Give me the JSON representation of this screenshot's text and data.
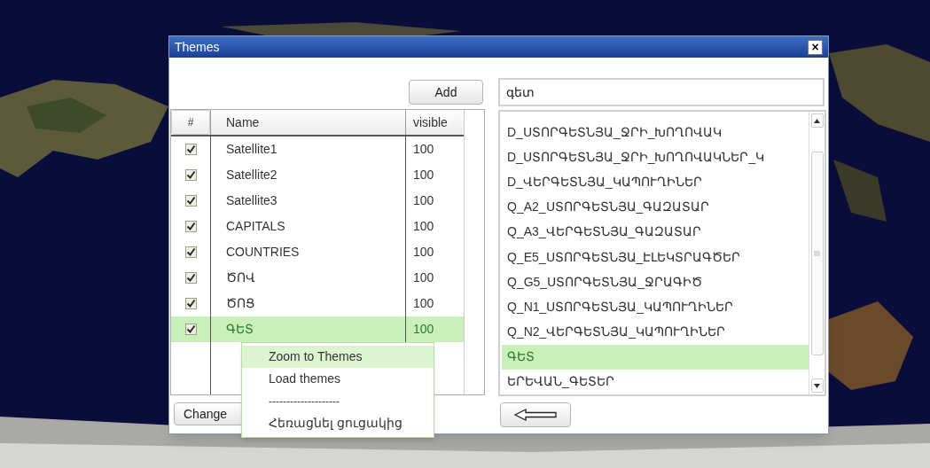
{
  "window": {
    "title": "Themes",
    "close": "×"
  },
  "add_button": "Add",
  "search": {
    "value": "գետ"
  },
  "table": {
    "columns": [
      "#",
      "Name",
      "visible"
    ],
    "rows": [
      {
        "checked": true,
        "name": "Satellite1",
        "visible": "100",
        "selected": false
      },
      {
        "checked": true,
        "name": "Satellite2",
        "visible": "100",
        "selected": false
      },
      {
        "checked": true,
        "name": "Satellite3",
        "visible": "100",
        "selected": false
      },
      {
        "checked": true,
        "name": "CAPITALS",
        "visible": "100",
        "selected": false
      },
      {
        "checked": true,
        "name": "COUNTRIES",
        "visible": "100",
        "selected": false
      },
      {
        "checked": true,
        "name": "ԾՈՎ",
        "visible": "100",
        "selected": false
      },
      {
        "checked": true,
        "name": "ԾՈՑ",
        "visible": "100",
        "selected": false
      },
      {
        "checked": true,
        "name": "ԳԵՏ",
        "visible": "100",
        "selected": true
      }
    ]
  },
  "change_button": "Change",
  "list": {
    "items": [
      {
        "label": "D_ՍՏՈՐԳԵՏՆՅԱ_ՋՐԻ_ԽՈՂՈՎԱԿ",
        "selected": false
      },
      {
        "label": "D_ՍՏՈՐԳԵՏՆՅԱ_ՋՐԻ_ԽՈՂՈՎԱԿՆԵՐ_Կ",
        "selected": false
      },
      {
        "label": "D_ՎԵՐԳԵՏՆՅԱ_ԿԱՊՈՒՂԻՆԵՐ",
        "selected": false
      },
      {
        "label": "Q_A2_ՍՏՈՐԳԵՏՆՅԱ_ԳԱԶԱՏԱՐ",
        "selected": false
      },
      {
        "label": "Q_A3_ՎԵՐԳԵՏՆՅԱ_ԳԱԶԱՏԱՐ",
        "selected": false
      },
      {
        "label": "Q_E5_ՍՏՈՐԳԵՏՆՅԱ_ԷԼԵԿՏՐԱԳԾԵՐ",
        "selected": false
      },
      {
        "label": "Q_G5_ՍՏՈՐԳԵՏՆՅԱ_ՋՐԱԳԻԾ",
        "selected": false
      },
      {
        "label": "Q_N1_ՍՏՈՐԳԵՏՆՅԱ_ԿԱՊՈՒՂԻՆԵՐ",
        "selected": false
      },
      {
        "label": "Q_N2_ՎԵՐԳԵՏՆՅԱ_ԿԱՊՈՒՂԻՆԵՐ",
        "selected": false
      },
      {
        "label": "ԳԵՏ",
        "selected": true
      },
      {
        "label": "ԵՐԵՎԱՆ_ԳԵՏԵՐ",
        "selected": false
      }
    ]
  },
  "context_menu": {
    "items": [
      {
        "kind": "item",
        "label": "Zoom to Themes",
        "selected": true
      },
      {
        "kind": "item",
        "label": "Load themes",
        "selected": false
      },
      {
        "kind": "separator",
        "label": "--------------------",
        "selected": false
      },
      {
        "kind": "item",
        "label": "Հեռացնել ցուցակից",
        "selected": false
      }
    ]
  }
}
